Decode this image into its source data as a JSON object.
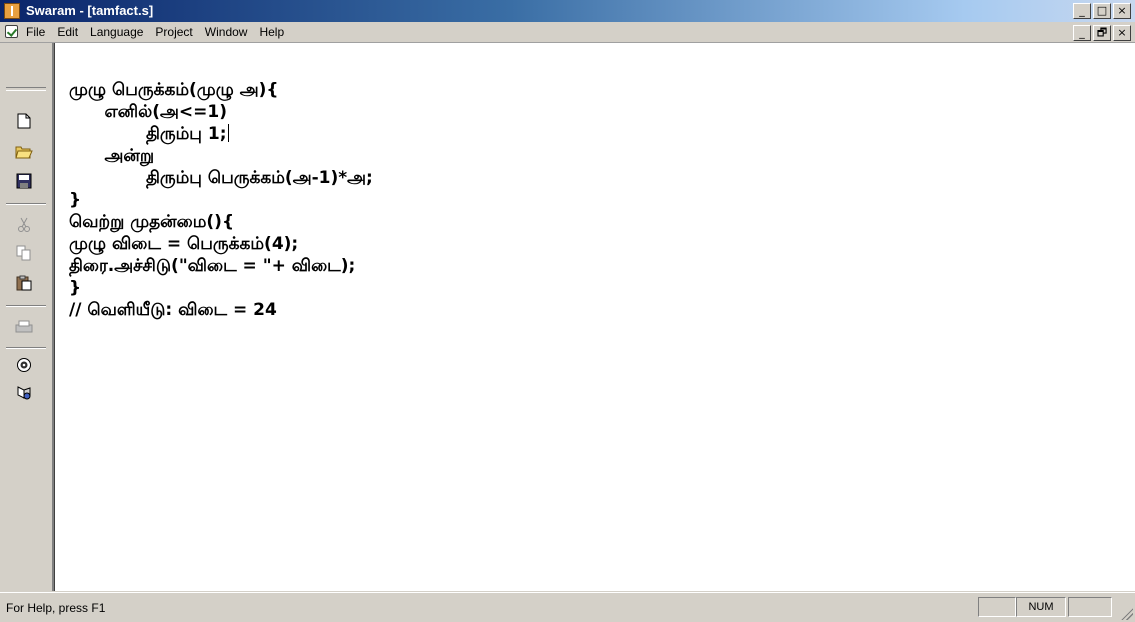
{
  "window": {
    "title": "Swaram - [tamfact.s]",
    "controls": [
      "_",
      "□",
      "×"
    ],
    "mdi_controls": [
      "_",
      "🗗",
      "×"
    ]
  },
  "menu": {
    "items": [
      "File",
      "Edit",
      "Language",
      "Project",
      "Window",
      "Help"
    ]
  },
  "toolbar": {
    "icons": [
      "new-file-icon",
      "open-folder-icon",
      "save-icon",
      "cut-icon",
      "copy-icon",
      "paste-icon",
      "print-icon",
      "compile-icon",
      "run-icon"
    ]
  },
  "editor": {
    "lines": [
      "முழு பெருக்கம்(முழு அ){",
      "      எனில்(அ<=1)",
      "             திரும்பு 1;",
      "      அன்று",
      "             திரும்பு பெருக்கம்(அ-1)*அ;",
      "}",
      "",
      "வெற்று முதன்மை(){",
      "முழு விடை = பெருக்கம்(4);",
      "திரை.அச்சிடு(\"விடை = \"+ விடை);",
      "}",
      "// வெளியீடு: விடை = 24"
    ]
  },
  "status": {
    "help_text": "For Help, press F1",
    "num_indicator": "NUM"
  }
}
